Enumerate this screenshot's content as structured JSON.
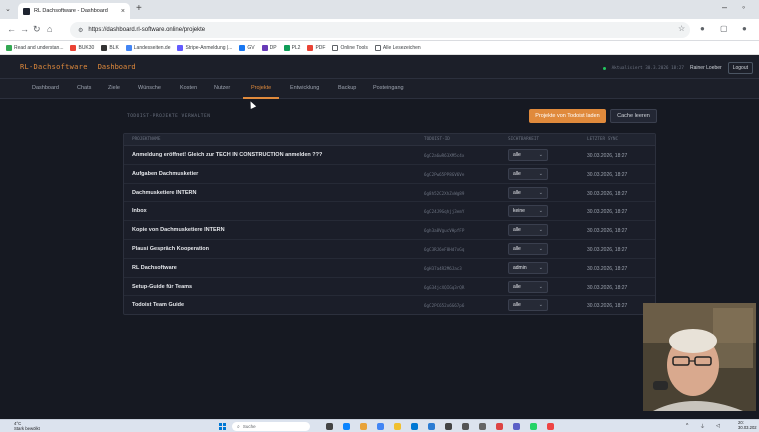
{
  "browser": {
    "tab_title": "RL Dachsoftware - Dashboard",
    "url": "https://dashboard.rl-software.online/projekte",
    "bookmarks": [
      "Read and understan...",
      "BUK30",
      "BLK",
      "Landesseiten.de",
      "Stripe-Anmeldung |...",
      "GV",
      "DP",
      "PL2",
      "PDF",
      "Online Tools",
      "Alle Lesezeichen"
    ]
  },
  "header": {
    "brand": "RL-Dachsoftware",
    "subtitle": "Dashboard",
    "status": "Aktualisiert 30.3.2026 18:27",
    "user": "Rainer Loeber",
    "logout": "Logout"
  },
  "nav": {
    "items": [
      "Dashboard",
      "Chats",
      "Ziele",
      "Wünsche",
      "Kosten",
      "Nutzer",
      "Projekte",
      "Entwicklung",
      "Backup",
      "Posteingang"
    ],
    "active": "Projekte"
  },
  "page": {
    "section_title": "TODOIST-PROJEKTE VERWALTEN",
    "load_button": "Projekte von Todoist laden",
    "clear_cache_button": "Cache leeren"
  },
  "table": {
    "headers": [
      "PROJEKTNAME",
      "TODOIST-ID",
      "SICHTBARKEIT",
      "LETZTER SYNC"
    ],
    "rows": [
      {
        "name": "Anmeldung eröffnet! Gleich zur TECH IN CONSTRUCTION anmelden ???",
        "id": "6gC2a6wR63XM5c4x",
        "visibility": "alle",
        "synced": "30.03.2026, 18:27"
      },
      {
        "name": "Aufgaben Dachmusketier",
        "id": "6gC2Pw65PP8GV6Ve",
        "visibility": "alle",
        "synced": "30.03.2026, 18:27"
      },
      {
        "name": "Dachmusketiere INTERN",
        "id": "6g8h52C2XhZvWg89",
        "visibility": "alle",
        "synced": "30.03.2026, 18:27"
      },
      {
        "name": "Inbox",
        "id": "6gC24J9Gqhjj3emY",
        "visibility": "keine",
        "synced": "30.03.2026, 18:27"
      },
      {
        "name": "Kopie von Dachmusketiere INTERN",
        "id": "6gh3a8VgucVHpfFP",
        "visibility": "alle",
        "synced": "30.03.2026, 18:27"
      },
      {
        "name": "Plausi Gespräch Kooperation",
        "id": "6gC3RJ6eF8Hd7xGq",
        "visibility": "alle",
        "synced": "30.03.2026, 18:27"
      },
      {
        "name": "RL Dachsoftware",
        "id": "6gH37a4R2M6Jac3",
        "visibility": "admin",
        "synced": "30.03.2026, 18:27"
      },
      {
        "name": "Setup-Guide für Teams",
        "id": "6gG34jcXQIGq3rQR",
        "visibility": "alle",
        "synced": "30.03.2026, 18:27"
      },
      {
        "name": "Todoist Team Guide",
        "id": "6gC2PC652x6G67p6",
        "visibility": "alle",
        "synced": "30.03.2026, 18:27"
      }
    ]
  },
  "taskbar": {
    "weather_temp": "4°C",
    "weather_desc": "Stark bewölkt",
    "search_placeholder": "Suche",
    "time": "20:",
    "date": "30.03.202"
  },
  "colors": {
    "accent": "#e08a3c",
    "background": "#161922",
    "panel": "#1b1e29",
    "status_online": "#22c55e"
  }
}
